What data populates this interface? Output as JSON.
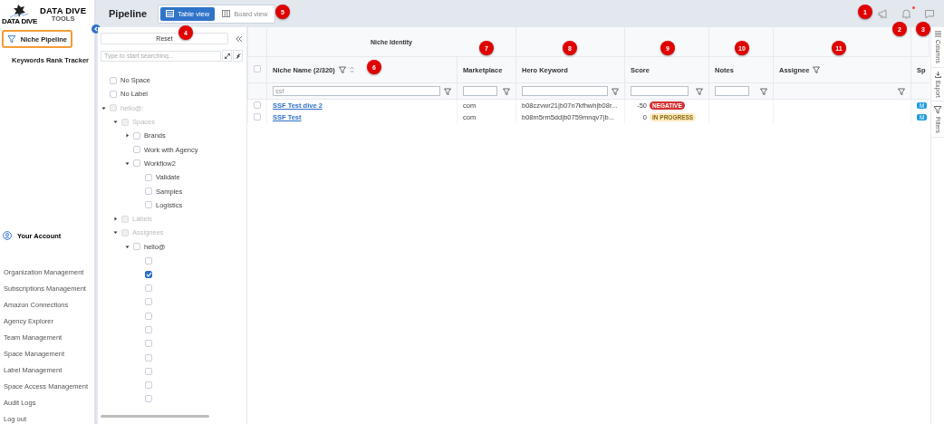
{
  "sidebar": {
    "logo": {
      "caption": "DATA DIVE",
      "title": "DATA DIVE",
      "subtitle": "TOOLS"
    },
    "nav": [
      {
        "label": "Niche Pipeline",
        "selected": true
      },
      {
        "label": "Keywords Rank Tracker",
        "selected": false
      }
    ],
    "account": "Your Account",
    "links": [
      "Organization Management",
      "Subscriptions Management",
      "Amazon Connections",
      "Agency Explorer",
      "Team Management",
      "Space Management",
      "Label Management",
      "Space Access Management",
      "Audit Logs",
      "Log out"
    ]
  },
  "header": {
    "title": "Pipeline",
    "views": [
      {
        "label": "Table view",
        "selected": true
      },
      {
        "label": "Board view",
        "selected": false
      }
    ],
    "notification_dot": true
  },
  "filter_panel": {
    "reset": "Reset",
    "search": {
      "placeholder": "Type to start searching..."
    },
    "tree": [
      {
        "label": "No Space",
        "checked": false,
        "disabled": false
      },
      {
        "label": "No Label",
        "checked": false,
        "disabled": false
      },
      {
        "label": "hello@:",
        "checked": false,
        "disabled": true,
        "expanded": true,
        "children": [
          {
            "label": "Spaces",
            "checked": false,
            "disabled": true,
            "expanded": true,
            "children": [
              {
                "label": "Brands",
                "checked": false,
                "disabled": false,
                "expanded": false
              },
              {
                "label": "Work with Agency",
                "checked": false,
                "disabled": false
              },
              {
                "label": "Workflow2",
                "checked": false,
                "disabled": false,
                "expanded": true,
                "children": [
                  {
                    "label": "Validate",
                    "checked": false,
                    "disabled": false
                  },
                  {
                    "label": "Samples",
                    "checked": false,
                    "disabled": false
                  },
                  {
                    "label": "Logistics",
                    "checked": false,
                    "disabled": false
                  }
                ]
              }
            ]
          },
          {
            "label": "Labels",
            "checked": false,
            "disabled": true,
            "expanded": false
          },
          {
            "label": "Assignees",
            "checked": false,
            "disabled": true,
            "expanded": true,
            "children": [
              {
                "label": "hello@",
                "checked": false,
                "disabled": false,
                "expanded": true,
                "children": [
                  {
                    "checked": false,
                    "disabled": false
                  },
                  {
                    "checked": true,
                    "disabled": false
                  },
                  {
                    "checked": false,
                    "disabled": false
                  },
                  {
                    "checked": false,
                    "disabled": false
                  },
                  {
                    "checked": false,
                    "disabled": false
                  },
                  {
                    "checked": false,
                    "disabled": false
                  },
                  {
                    "checked": false,
                    "disabled": false
                  },
                  {
                    "checked": false,
                    "disabled": false
                  },
                  {
                    "checked": false,
                    "disabled": false
                  },
                  {
                    "checked": false,
                    "disabled": false
                  },
                  {
                    "checked": false,
                    "disabled": false
                  }
                ]
              }
            ]
          }
        ]
      }
    ]
  },
  "table": {
    "all_selected": false,
    "groups": [
      "Niche Identity"
    ],
    "columns": [
      {
        "label": "Niche Name (2/320)",
        "filter_icon": true,
        "sort_icon": true,
        "filter": {
          "kind": "input",
          "value": "ssf"
        }
      },
      {
        "label": "Marketplace",
        "filter": {
          "kind": "input"
        }
      },
      {
        "label": "Hero Keyword",
        "filter": {
          "kind": "input"
        }
      },
      {
        "label": "Score",
        "filter": {
          "kind": "input"
        }
      },
      {
        "label": "Notes",
        "filter": {
          "kind": "input"
        }
      },
      {
        "label": "Assignee",
        "filter_icon": true,
        "filter": {
          "kind": "icon"
        }
      },
      {
        "label": "Sp",
        "filter": {
          "kind": "none"
        }
      }
    ],
    "rows": [
      {
        "selected": false,
        "name": "SSF Test dive 2",
        "marketplace": "com",
        "hero_keyword": "b08czvwr21|b07n7kfhwh|b08r...",
        "score": "-50",
        "status": {
          "text": "NEGATIVE",
          "color": "#d32f2f"
        },
        "column_7": "M"
      },
      {
        "selected": false,
        "name": "SSF Test",
        "marketplace": "com",
        "hero_keyword": "b08m5rm5dd|b0759mnqv7|b...",
        "score": "0",
        "status": {
          "text": "IN PROGRESS",
          "color": "#fdebc0"
        },
        "column_7": "M"
      }
    ]
  },
  "side_tabs": [
    "Columns",
    "Export",
    "Filters"
  ],
  "callouts": [
    "1",
    "2",
    "3",
    "4",
    "5",
    "6",
    "7",
    "8",
    "9",
    "10",
    "11"
  ]
}
